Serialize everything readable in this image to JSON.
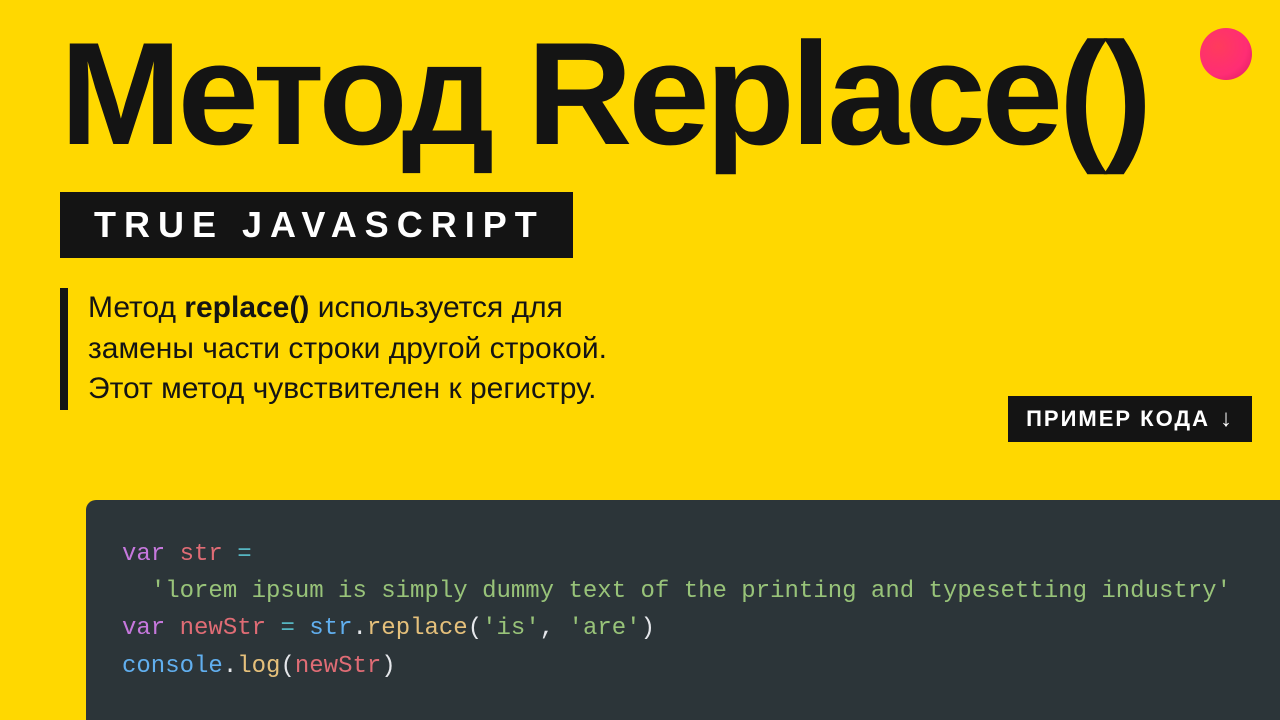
{
  "title": "Метод Replace()",
  "badge": "TRUE JAVASCRIPT",
  "description": {
    "pre": "Метод ",
    "bold": "replace()",
    "post": " используется для замены части строки другой строкой. Этот метод чувствителен к регистру."
  },
  "example_label": "ПРИМЕР КОДА",
  "code": {
    "string_literal": "'lorem ipsum is simply dummy text of the printing and typesetting industry'",
    "arg1": "'is'",
    "arg2": "'are'",
    "kw_var": "var",
    "id_str": "str",
    "id_newStr": "newStr",
    "id_console": "console",
    "fn_replace": "replace",
    "fn_log": "log"
  }
}
